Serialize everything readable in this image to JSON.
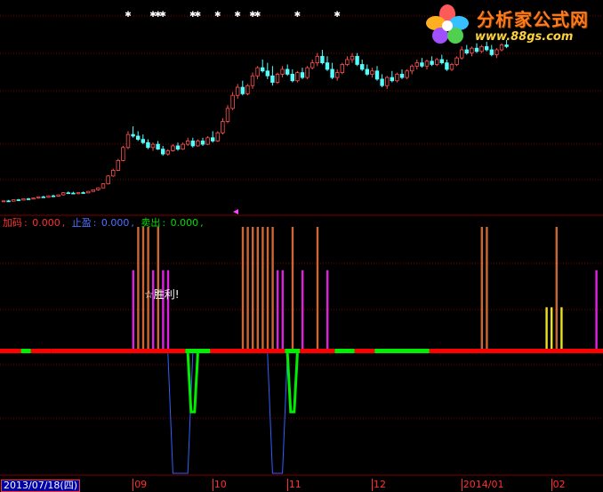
{
  "logo": {
    "title": "分析家公式网",
    "url": "www.88gs.com"
  },
  "legend": {
    "jiama_label": "加码",
    "jiama_value": "0.000",
    "zhiying_label": "止盈",
    "zhiying_value": "0.000",
    "maichu_label": "卖出",
    "maichu_value": "0.000",
    "separator": ": ",
    "comma": ","
  },
  "annotation": {
    "win_text": "☆胜利!"
  },
  "axis": {
    "date_box": "2013/07/18(四)",
    "months": [
      {
        "label": "09",
        "x_index": 27
      },
      {
        "label": "10",
        "x_index": 43
      },
      {
        "label": "11",
        "x_index": 58
      },
      {
        "label": "12",
        "x_index": 75
      },
      {
        "label": "2014/01",
        "x_index": 93
      },
      {
        "label": "02",
        "x_index": 111
      }
    ]
  },
  "colors": {
    "background": "#000000",
    "grid": "#800000",
    "up_candle": "#ff5050",
    "down_candle": "#54fcfc",
    "jiama": "#cc6633",
    "zhiying": "#e020e0",
    "maichu": "#e8e020",
    "red_band": "#ff0000",
    "green_band": "#00ee00",
    "green_line": "#00ee00",
    "blue_line": "#3060ff",
    "legend_jiama": "#ff3030",
    "legend_zhiying": "#5070ff",
    "legend_maichu": "#00dd00"
  },
  "chart_data": {
    "type": "candlestick-with-signals",
    "candles": [
      [
        1.0,
        1.5,
        0.5,
        1.2
      ],
      [
        1.2,
        1.8,
        0.9,
        1.0
      ],
      [
        1.0,
        2.0,
        0.8,
        1.9
      ],
      [
        1.9,
        2.4,
        1.5,
        1.7
      ],
      [
        1.7,
        2.6,
        1.5,
        2.5
      ],
      [
        2.5,
        3.0,
        2.0,
        2.3
      ],
      [
        2.3,
        3.2,
        2.1,
        3.0
      ],
      [
        3.0,
        4.0,
        2.6,
        3.7
      ],
      [
        3.7,
        4.3,
        3.2,
        3.4
      ],
      [
        3.4,
        4.5,
        3.1,
        4.3
      ],
      [
        4.3,
        5.0,
        3.9,
        4.1
      ],
      [
        4.1,
        5.2,
        3.8,
        4.9
      ],
      [
        4.9,
        6.5,
        4.5,
        6.2
      ],
      [
        6.2,
        7.0,
        5.8,
        6.0
      ],
      [
        6.0,
        6.8,
        5.4,
        5.6
      ],
      [
        5.6,
        6.5,
        5.2,
        6.3
      ],
      [
        6.3,
        7.0,
        5.9,
        6.1
      ],
      [
        6.1,
        7.2,
        5.8,
        7.0
      ],
      [
        7.0,
        8.2,
        6.7,
        8.0
      ],
      [
        8.0,
        9.5,
        7.5,
        9.2
      ],
      [
        9.2,
        12.0,
        8.9,
        11.7
      ],
      [
        11.7,
        17.0,
        11.3,
        16.5
      ],
      [
        16.5,
        21.0,
        16.0,
        20.0
      ],
      [
        20.0,
        27.0,
        19.5,
        26.0
      ],
      [
        26.0,
        35.0,
        25.5,
        34.0
      ],
      [
        34.0,
        44.0,
        33.0,
        42.0
      ],
      [
        42.0,
        47.0,
        40.0,
        41.0
      ],
      [
        41.0,
        44.0,
        38.0,
        39.0
      ],
      [
        39.0,
        42.0,
        36.0,
        37.0
      ],
      [
        37.0,
        39.0,
        33.0,
        34.0
      ],
      [
        34.0,
        37.0,
        32.0,
        36.0
      ],
      [
        36.0,
        38.0,
        32.5,
        33.0
      ],
      [
        33.0,
        35.0,
        29.0,
        30.0
      ],
      [
        30.0,
        33.0,
        29.0,
        32.0
      ],
      [
        32.0,
        36.0,
        31.5,
        35.0
      ],
      [
        35.0,
        37.0,
        32.0,
        33.0
      ],
      [
        33.0,
        37.0,
        32.5,
        36.0
      ],
      [
        36.0,
        40.0,
        35.0,
        38.0
      ],
      [
        38.0,
        40.0,
        34.0,
        35.0
      ],
      [
        35.0,
        39.0,
        34.5,
        38.0
      ],
      [
        38.0,
        40.0,
        35.0,
        36.0
      ],
      [
        36.0,
        41.0,
        35.5,
        40.0
      ],
      [
        40.0,
        44.0,
        37.0,
        38.0
      ],
      [
        38.0,
        44.0,
        37.5,
        43.0
      ],
      [
        43.0,
        52.0,
        42.0,
        50.0
      ],
      [
        50.0,
        60.0,
        49.0,
        58.0
      ],
      [
        58.0,
        68.0,
        57.0,
        66.0
      ],
      [
        66.0,
        73.0,
        64.0,
        71.0
      ],
      [
        71.0,
        75.0,
        66.0,
        67.0
      ],
      [
        67.0,
        73.0,
        66.0,
        72.0
      ],
      [
        72.0,
        80.0,
        70.0,
        78.0
      ],
      [
        78.0,
        84.0,
        76.0,
        83.0
      ],
      [
        83.0,
        88.0,
        80.0,
        81.0
      ],
      [
        81.0,
        86.0,
        76.0,
        78.0
      ],
      [
        78.0,
        84.0,
        72.0,
        74.0
      ],
      [
        74.0,
        80.0,
        73.0,
        79.0
      ],
      [
        79.0,
        84.0,
        77.0,
        82.0
      ],
      [
        82.0,
        85.0,
        78.0,
        79.0
      ],
      [
        79.0,
        82.0,
        74.0,
        75.0
      ],
      [
        75.0,
        81.0,
        74.0,
        80.0
      ],
      [
        80.0,
        83.0,
        76.0,
        77.0
      ],
      [
        77.0,
        84.0,
        76.0,
        83.0
      ],
      [
        83.0,
        88.0,
        82.0,
        86.0
      ],
      [
        86.0,
        92.0,
        84.0,
        90.0
      ],
      [
        90.0,
        94.0,
        85.0,
        86.0
      ],
      [
        86.0,
        90.0,
        81.0,
        82.0
      ],
      [
        82.0,
        86.0,
        76.0,
        77.0
      ],
      [
        77.0,
        82.0,
        75.0,
        80.0
      ],
      [
        80.0,
        86.0,
        79.0,
        85.0
      ],
      [
        85.0,
        90.0,
        84.0,
        88.0
      ],
      [
        88.0,
        92.0,
        86.0,
        90.0
      ],
      [
        90.0,
        92.0,
        84.0,
        85.0
      ],
      [
        85.0,
        88.0,
        81.0,
        82.0
      ],
      [
        82.0,
        85.0,
        78.0,
        79.0
      ],
      [
        79.0,
        83.0,
        77.0,
        81.0
      ],
      [
        81.0,
        84.0,
        75.0,
        76.0
      ],
      [
        76.0,
        79.0,
        71.0,
        72.0
      ],
      [
        72.0,
        78.0,
        70.0,
        77.0
      ],
      [
        77.0,
        81.0,
        74.0,
        75.0
      ],
      [
        75.0,
        80.0,
        74.0,
        79.0
      ],
      [
        79.0,
        82.0,
        76.0,
        77.0
      ],
      [
        77.0,
        82.0,
        76.0,
        81.0
      ],
      [
        81.0,
        85.0,
        79.0,
        84.0
      ],
      [
        84.0,
        88.0,
        82.0,
        86.0
      ],
      [
        86.0,
        89.0,
        83.0,
        84.0
      ],
      [
        84.0,
        88.0,
        82.0,
        87.0
      ],
      [
        87.0,
        90.0,
        84.0,
        85.0
      ],
      [
        85.0,
        89.0,
        84.0,
        88.0
      ],
      [
        88.0,
        91.0,
        85.0,
        86.0
      ],
      [
        86.0,
        88.0,
        81.0,
        82.0
      ],
      [
        82.0,
        86.0,
        81.0,
        85.0
      ],
      [
        85.0,
        90.0,
        84.0,
        89.0
      ],
      [
        89.0,
        96.0,
        88.0,
        94.0
      ],
      [
        94.0,
        97.0,
        91.0,
        92.0
      ],
      [
        92.0,
        96.0,
        90.0,
        95.0
      ],
      [
        95.0,
        98.0,
        92.0,
        93.0
      ],
      [
        93.0,
        97.0,
        92.0,
        96.0
      ],
      [
        96.0,
        99.0,
        93.0,
        94.0
      ],
      [
        94.0,
        97.0,
        90.0,
        91.0
      ],
      [
        91.0,
        95.0,
        89.0,
        94.0
      ],
      [
        94.0,
        98.0,
        93.0,
        97.0
      ],
      [
        97.0,
        100.0,
        95.0,
        96.0
      ]
    ],
    "y_range": [
      0,
      100
    ],
    "signal_range": [
      0,
      100
    ],
    "jiama_bars": [
      {
        "i": 27,
        "v": 100
      },
      {
        "i": 28,
        "v": 100
      },
      {
        "i": 29,
        "v": 100
      },
      {
        "i": 31,
        "v": 100
      },
      {
        "i": 48,
        "v": 100
      },
      {
        "i": 49,
        "v": 100
      },
      {
        "i": 50,
        "v": 100
      },
      {
        "i": 51,
        "v": 100
      },
      {
        "i": 52,
        "v": 100
      },
      {
        "i": 53,
        "v": 100
      },
      {
        "i": 54,
        "v": 100
      },
      {
        "i": 58,
        "v": 100
      },
      {
        "i": 63,
        "v": 100
      },
      {
        "i": 96,
        "v": 100
      },
      {
        "i": 97,
        "v": 100
      },
      {
        "i": 111,
        "v": 100
      }
    ],
    "zhiying_bars": [
      {
        "i": 26,
        "v": 65
      },
      {
        "i": 30,
        "v": 65
      },
      {
        "i": 32,
        "v": 65
      },
      {
        "i": 33,
        "v": 65
      },
      {
        "i": 55,
        "v": 65
      },
      {
        "i": 56,
        "v": 65
      },
      {
        "i": 60,
        "v": 65
      },
      {
        "i": 65,
        "v": 65
      },
      {
        "i": 119,
        "v": 65
      }
    ],
    "maichu_bars": [
      {
        "i": 109,
        "v": 35
      },
      {
        "i": 110,
        "v": 35
      },
      {
        "i": 112,
        "v": 35
      }
    ],
    "band": [
      {
        "from": 0,
        "to": 4,
        "color": "red"
      },
      {
        "from": 4,
        "to": 6,
        "color": "green"
      },
      {
        "from": 6,
        "to": 10,
        "color": "red"
      },
      {
        "from": 10,
        "to": 37,
        "color": "red"
      },
      {
        "from": 37,
        "to": 42,
        "color": "green"
      },
      {
        "from": 42,
        "to": 57,
        "color": "red"
      },
      {
        "from": 57,
        "to": 60,
        "color": "green"
      },
      {
        "from": 60,
        "to": 67,
        "color": "red"
      },
      {
        "from": 67,
        "to": 71,
        "color": "green"
      },
      {
        "from": 71,
        "to": 75,
        "color": "red"
      },
      {
        "from": 75,
        "to": 86,
        "color": "green"
      },
      {
        "from": 86,
        "to": 120,
        "color": "red"
      }
    ],
    "blue_dips": [
      {
        "start": 33,
        "bottom_start": 34,
        "bottom_end": 37,
        "end": 38
      },
      {
        "start": 53,
        "bottom_start": 54,
        "bottom_end": 56,
        "end": 57
      }
    ],
    "green_dips": [
      {
        "start": 37,
        "bottom": 38,
        "end": 39
      },
      {
        "start": 57,
        "bottom": 58,
        "end": 59
      }
    ],
    "top_markers": [
      25,
      30,
      31,
      32,
      38,
      39,
      43,
      47,
      50,
      51,
      59,
      67
    ]
  }
}
